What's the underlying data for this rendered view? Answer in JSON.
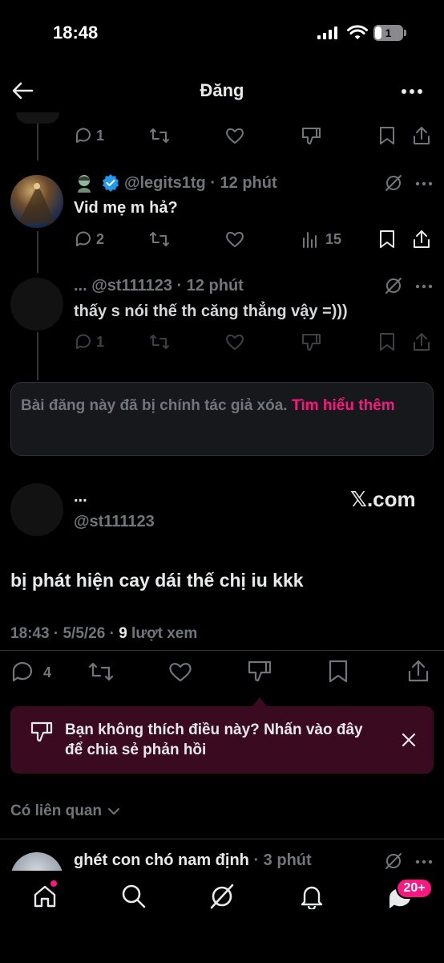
{
  "status_bar": {
    "time": "18:48",
    "battery": "1"
  },
  "header": {
    "title": "Đăng"
  },
  "reply1": {
    "reply_count": "1"
  },
  "reply2": {
    "handle": "@legits1tg",
    "time": "· 12 phút",
    "text": "Vid mẹ m hả?",
    "reply_count": "2",
    "view_count": "15"
  },
  "reply3": {
    "name": "...",
    "handle": "@st111123",
    "time": "· 12 phút",
    "text": "thấy s nói thế th căng thẳng vậy =)))",
    "reply_count": "1"
  },
  "deleted_notice": {
    "text": "Bài đăng này đã bị chính tác giả xóa. ",
    "link": "Tìm hiểu thêm"
  },
  "main_post": {
    "name": "...",
    "handle": "@st111123",
    "watermark": "𝕏.com",
    "text": "bị phát hiện cay dái thế chị iu kkk",
    "timestamp": "18:43 · 5/5/26 · ",
    "views_number": "9",
    "views_label": " lượt xem",
    "reply_count": "4"
  },
  "feedback": {
    "text": "Bạn không thích điều này? Nhấn vào đây để chia sẻ phản hồi"
  },
  "related": {
    "label": "Có liên quan",
    "next_name": "ghét con chó nam định",
    "next_time": "· 3 phút"
  },
  "tabbar": {
    "badge": "20+"
  },
  "colors": {
    "background": "#000000",
    "text": "#e7e9ea",
    "secondary": "#71767b",
    "accent": "#f91880",
    "verified": "#1d9bf0"
  }
}
